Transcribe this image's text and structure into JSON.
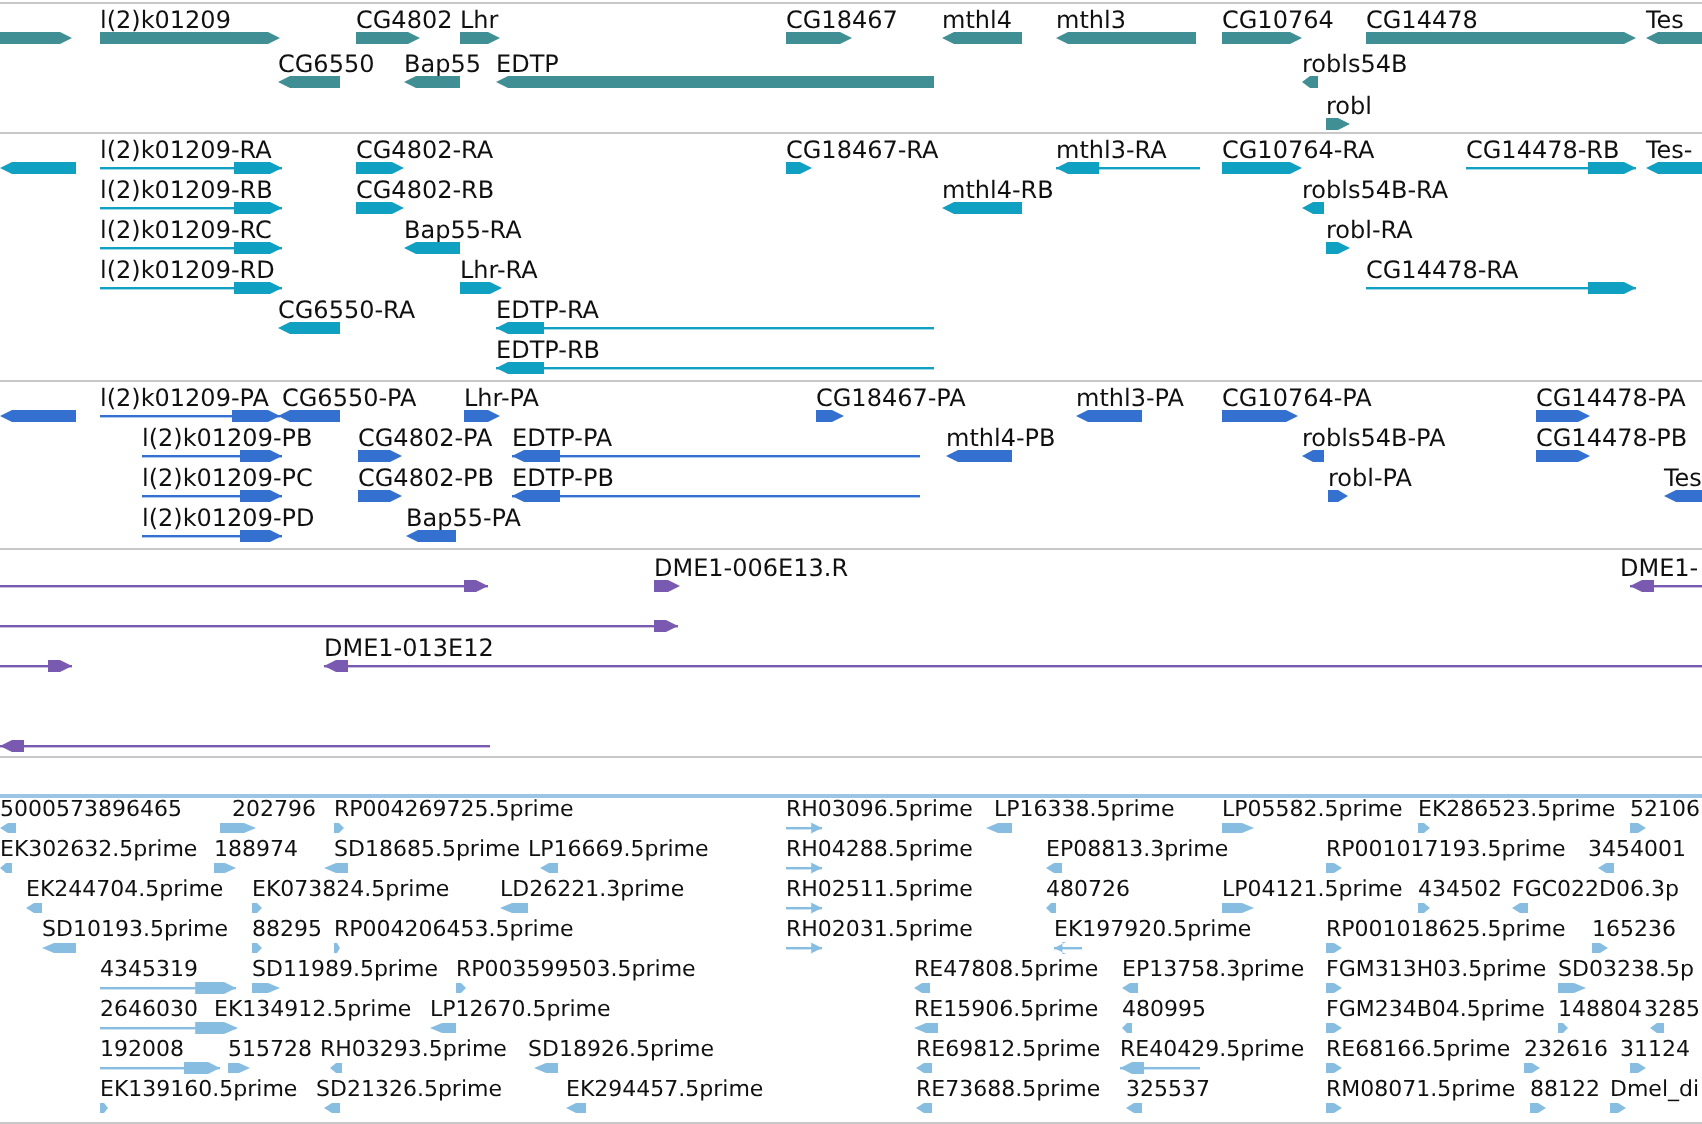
{
  "tracks": [
    {
      "kind": "gene",
      "features": [
        {
          "reverse": false
        },
        {
          "label": "l(2)k01209",
          "reverse": false
        },
        {
          "label": "CG6550",
          "reverse": true
        },
        {
          "label": "CG4802",
          "reverse": false
        },
        {
          "label": "Lhr",
          "reverse": false
        },
        {
          "label": "Bap55",
          "reverse": true
        },
        {
          "label": "EDTP",
          "reverse": true
        },
        {
          "label": "CG18467",
          "reverse": false
        },
        {
          "label": "mthl4",
          "reverse": true
        },
        {
          "label": "mthl3",
          "reverse": true
        },
        {
          "label": "CG10764",
          "reverse": false
        },
        {
          "label": "CG14478",
          "reverse": false
        },
        {
          "label": "Tes",
          "reverse": true
        },
        {
          "label": "robls54B",
          "reverse": true
        },
        {
          "label": "robl",
          "reverse": false
        }
      ]
    },
    {
      "kind": "transcript",
      "features": [
        {
          "reverse": true
        },
        {
          "label": "l(2)k01209-RA",
          "reverse": false
        },
        {
          "label": "l(2)k01209-RB",
          "reverse": false
        },
        {
          "label": "l(2)k01209-RC",
          "reverse": false
        },
        {
          "label": "l(2)k01209-RD",
          "reverse": false
        },
        {
          "label": "CG4802-RA",
          "reverse": false
        },
        {
          "label": "CG4802-RB",
          "reverse": false
        },
        {
          "label": "Bap55-RA",
          "reverse": true
        },
        {
          "label": "Lhr-RA",
          "reverse": false
        },
        {
          "label": "CG6550-RA",
          "reverse": true
        },
        {
          "label": "EDTP-RA",
          "reverse": true
        },
        {
          "label": "EDTP-RB",
          "reverse": true
        },
        {
          "label": "CG18467-RA",
          "reverse": false
        },
        {
          "label": "mthl3-RA",
          "reverse": true
        },
        {
          "label": "mthl4-RB",
          "reverse": true
        },
        {
          "label": "CG10764-RA",
          "reverse": false
        },
        {
          "label": "robls54B-RA",
          "reverse": true
        },
        {
          "label": "robl-RA",
          "reverse": false
        },
        {
          "label": "CG14478-RB",
          "reverse": false
        },
        {
          "label": "CG14478-RA",
          "reverse": false
        },
        {
          "label": "Tes-",
          "reverse": true
        }
      ]
    },
    {
      "kind": "protein",
      "features": [
        {
          "reverse": true
        },
        {
          "label": "l(2)k01209-PA",
          "reverse": false
        },
        {
          "label": "CG6550-PA",
          "reverse": true
        },
        {
          "label": "Lhr-PA",
          "reverse": false
        },
        {
          "label": "CG18467-PA",
          "reverse": false
        },
        {
          "label": "mthl3-PA",
          "reverse": true
        },
        {
          "label": "CG10764-PA",
          "reverse": false
        },
        {
          "label": "CG14478-PA",
          "reverse": false
        },
        {
          "label": "l(2)k01209-PB",
          "reverse": false
        },
        {
          "label": "CG4802-PA",
          "reverse": false
        },
        {
          "label": "EDTP-PA",
          "reverse": true
        },
        {
          "label": "mthl4-PB",
          "reverse": true
        },
        {
          "label": "robls54B-PA",
          "reverse": true
        },
        {
          "label": "CG14478-PB",
          "reverse": false
        },
        {
          "label": "l(2)k01209-PC",
          "reverse": false
        },
        {
          "label": "CG4802-PB",
          "reverse": false
        },
        {
          "label": "EDTP-PB",
          "reverse": true
        },
        {
          "label": "robl-PA",
          "reverse": false
        },
        {
          "label": "Tes",
          "reverse": true
        },
        {
          "label": "l(2)k01209-PD",
          "reverse": false
        },
        {
          "label": "Bap55-PA",
          "reverse": true
        }
      ]
    },
    {
      "kind": "clone",
      "features": [
        {
          "reverse": false
        },
        {
          "label": "DME1-006E13.R",
          "reverse": false
        },
        {
          "label": "DME1-",
          "reverse": true
        },
        {
          "reverse": false
        },
        {
          "reverse": false
        },
        {
          "label": "DME1-013E12",
          "reverse": true
        },
        {
          "reverse": true
        }
      ]
    },
    {
      "kind": "est",
      "features": [
        {
          "label": "5000573896465",
          "reverse": true
        },
        {
          "label": "202796",
          "reverse": false
        },
        {
          "label": "RP004269725.5prime",
          "reverse": false
        },
        {
          "label": "RH03096.5prime",
          "reverse": false
        },
        {
          "label": "LP16338.5prime",
          "reverse": true
        },
        {
          "label": "LP05582.5prime",
          "reverse": false
        },
        {
          "label": "EK286523.5prime",
          "reverse": false
        },
        {
          "label": "52106",
          "reverse": false
        },
        {
          "label": "EK302632.5prime",
          "reverse": true
        },
        {
          "label": "188974",
          "reverse": false
        },
        {
          "label": "SD18685.5prime",
          "reverse": true
        },
        {
          "label": "LP16669.5prime",
          "reverse": true
        },
        {
          "label": "RH04288.5prime",
          "reverse": false
        },
        {
          "label": "EP08813.3prime",
          "reverse": true
        },
        {
          "label": "RP001017193.5prime",
          "reverse": false
        },
        {
          "label": "3454001",
          "reverse": true
        },
        {
          "label": "EK244704.5prime",
          "reverse": true
        },
        {
          "label": "EK073824.5prime",
          "reverse": false
        },
        {
          "label": "LD26221.3prime",
          "reverse": true
        },
        {
          "label": "RH02511.5prime",
          "reverse": false
        },
        {
          "label": "480726",
          "reverse": true
        },
        {
          "label": "LP04121.5prime",
          "reverse": false
        },
        {
          "label": "434502",
          "reverse": false
        },
        {
          "label": "FGC022D06.3p",
          "reverse": true
        },
        {
          "label": "SD10193.5prime",
          "reverse": true
        },
        {
          "label": "88295",
          "reverse": false
        },
        {
          "label": "RP004206453.5prime",
          "reverse": false
        },
        {
          "label": "RH02031.5prime",
          "reverse": false
        },
        {
          "label": "EK197920.5prime",
          "reverse": true
        },
        {
          "label": "RP001018625.5prime",
          "reverse": false
        },
        {
          "label": "165236",
          "reverse": false
        },
        {
          "label": "4345319",
          "reverse": false
        },
        {
          "label": "SD11989.5prime",
          "reverse": false
        },
        {
          "label": "RP003599503.5prime",
          "reverse": false
        },
        {
          "label": "RE47808.5prime",
          "reverse": true
        },
        {
          "label": "EP13758.3prime",
          "reverse": true
        },
        {
          "label": "FGM313H03.5prime",
          "reverse": false
        },
        {
          "label": "SD03238.5p",
          "reverse": false
        },
        {
          "label": "2646030",
          "reverse": false
        },
        {
          "label": "EK134912.5prime",
          "reverse": false
        },
        {
          "label": "LP12670.5prime",
          "reverse": true
        },
        {
          "label": "RE15906.5prime",
          "reverse": true
        },
        {
          "label": "480995",
          "reverse": true
        },
        {
          "label": "FGM234B04.5prime",
          "reverse": false
        },
        {
          "label": "148804",
          "reverse": false
        },
        {
          "label": "3285",
          "reverse": true
        },
        {
          "label": "192008",
          "reverse": false
        },
        {
          "label": "515728",
          "reverse": false
        },
        {
          "label": "RH03293.5prime",
          "reverse": true
        },
        {
          "label": "SD18926.5prime",
          "reverse": true
        },
        {
          "label": "RE69812.5prime",
          "reverse": true
        },
        {
          "label": "RE40429.5prime",
          "reverse": true
        },
        {
          "label": "RE68166.5prime",
          "reverse": false
        },
        {
          "label": "232616",
          "reverse": false
        },
        {
          "label": "31124",
          "reverse": false
        },
        {
          "label": "EK139160.5prime",
          "reverse": false
        },
        {
          "label": "SD21326.5prime",
          "reverse": true
        },
        {
          "label": "EK294457.5prime",
          "reverse": true
        },
        {
          "label": "RE73688.5prime",
          "reverse": true
        },
        {
          "label": "325537",
          "reverse": true
        },
        {
          "label": "RM08071.5prime",
          "reverse": false
        },
        {
          "label": "88122",
          "reverse": false
        },
        {
          "label": "Dmel_di",
          "reverse": false
        }
      ]
    }
  ]
}
